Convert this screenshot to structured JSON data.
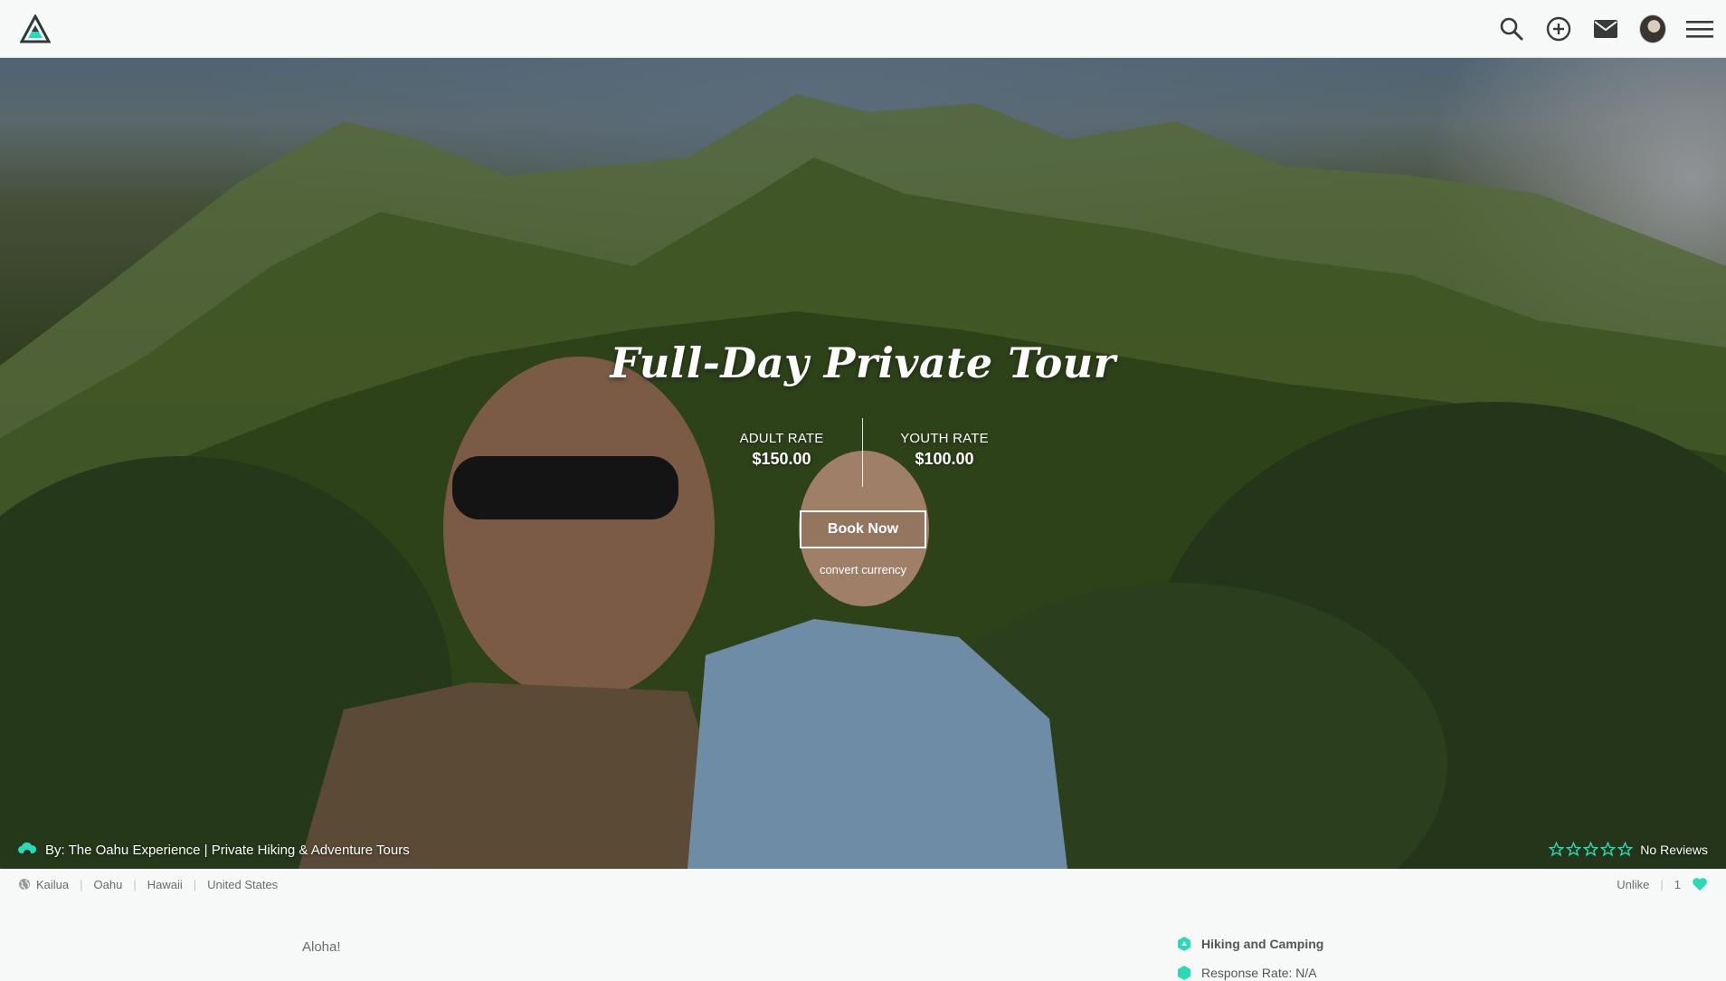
{
  "nav": {
    "logo": "mountain-logo-icon",
    "icons": [
      "search-icon",
      "add-circle-icon",
      "mail-icon",
      "avatar",
      "menu-icon"
    ]
  },
  "hero": {
    "title": "Full-Day Private Tour",
    "adult_rate_label": "ADULT RATE",
    "adult_rate_value": "$150.00",
    "youth_rate_label": "YOUTH RATE",
    "youth_rate_value": "$100.00",
    "book_label": "Book Now",
    "convert_label": "convert currency",
    "by_line": "By: The Oahu Experience | Private Hiking & Adventure Tours",
    "rating": 0,
    "rating_max": 5,
    "reviews_label": "No Reviews"
  },
  "location": {
    "items": [
      "Kailua",
      "Oahu",
      "Hawaii",
      "United States"
    ],
    "unlike_label": "Unlike",
    "like_count": "1"
  },
  "content": {
    "greeting": "Aloha!",
    "category": "Hiking and Camping",
    "response_rate_label": "Response Rate: N/A"
  },
  "colors": {
    "accent": "#2bd9b6",
    "white": "#ffffff",
    "page_bg": "#f7f8f8"
  }
}
